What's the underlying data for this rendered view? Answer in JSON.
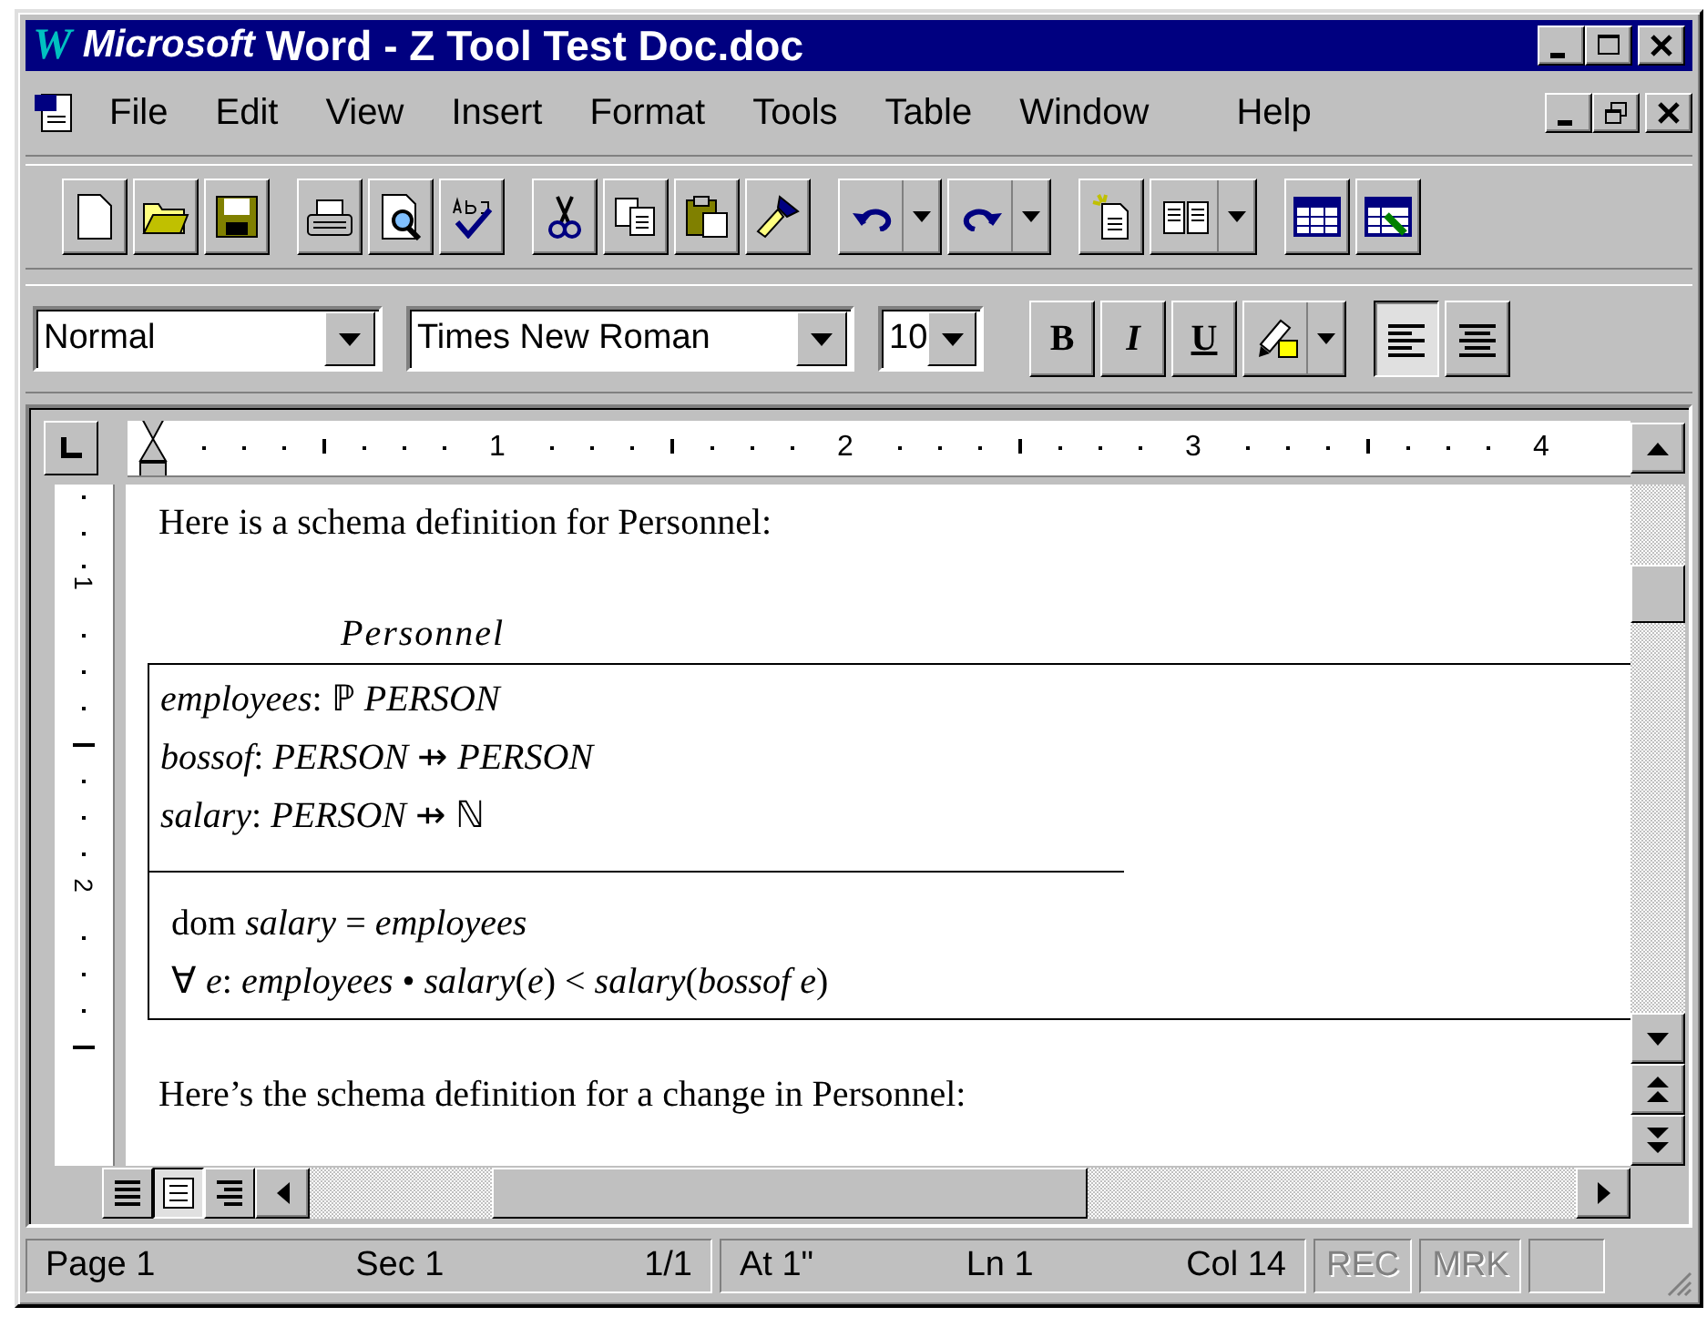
{
  "window": {
    "logo_letter": "W",
    "brand": "Microsoft",
    "title": "Word - Z Tool Test Doc.doc"
  },
  "menu": [
    "File",
    "Edit",
    "View",
    "Insert",
    "Format",
    "Tools",
    "Table",
    "Window",
    "Help"
  ],
  "formatting": {
    "style": "Normal",
    "font": "Times New Roman",
    "size": "10",
    "buttons": [
      {
        "kind": "bold",
        "label": "B",
        "selected": false
      },
      {
        "kind": "italic",
        "label": "I",
        "selected": false
      },
      {
        "kind": "underline",
        "label": "U",
        "selected": false
      }
    ],
    "align": [
      {
        "kind": "left",
        "selected": true
      },
      {
        "kind": "center",
        "selected": false
      }
    ]
  },
  "ruler": {
    "marks": [
      "1",
      "2",
      "3",
      "4"
    ],
    "vertical_marks": [
      "1",
      "2"
    ]
  },
  "document": {
    "intro": "Here is a schema definition for Personnel:",
    "schema": {
      "name": "Personnel",
      "declarations": [
        "*employees*: ℙ  *PERSON*",
        "*bossof*: *PERSON* ⇸ *PERSON*",
        "*salary*: *PERSON* ⇸ ℕ"
      ],
      "predicates": [
        "dom *salary* = *employees*",
        "∀ *e*: *employees* • *salary*(*e*) < *salary*(*bossof e*)"
      ]
    },
    "outro": "Here’s the schema definition for a change in Personnel:"
  },
  "status_bar": {
    "page": "Page 1",
    "section": "Sec 1",
    "pages": "1/1",
    "at": "At 1\"",
    "line": "Ln 1",
    "column": "Col 14",
    "indicators": [
      {
        "label": "REC",
        "disabled": true
      },
      {
        "label": "MRK",
        "disabled": true
      }
    ]
  }
}
